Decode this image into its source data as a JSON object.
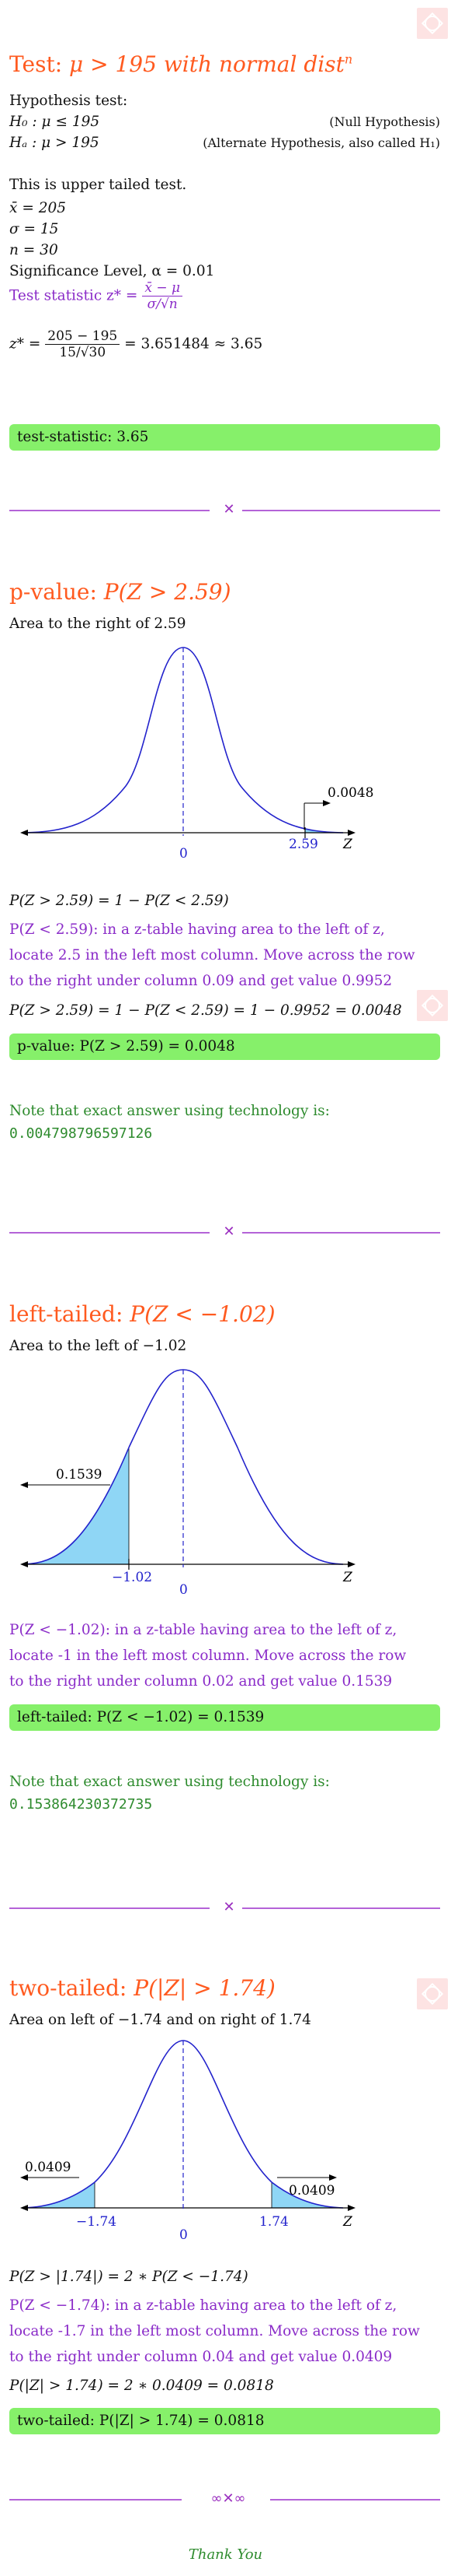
{
  "section1": {
    "title_prefix": "Test: ",
    "title_math": "μ > 195 with normal dist",
    "title_sup": "n",
    "hyp_heading": "Hypothesis test:",
    "h0": "H₀ : μ ≤ 195",
    "h0_note": "(Null Hypothesis)",
    "ha": "Hₐ : μ > 195",
    "ha_note": "(Alternate Hypothesis, also called H₁)",
    "tail_text": "This is upper tailed test.",
    "xbar": "x̄ = 205",
    "sigma": "σ = 15",
    "n": "n = 30",
    "significance": "Significance Level, α = 0.01",
    "ts_label": "Test statistic z* =",
    "ts_num": "x̄ − μ",
    "ts_den": "σ/√n",
    "z_label": "z* =",
    "z_num": "205 − 195",
    "z_den": "15/√30",
    "z_result": "= 3.651484 ≈ 3.65",
    "box": "test-statistic:  3.65"
  },
  "section2": {
    "title_prefix": "p-value: ",
    "title_math": "P(Z > 2.59)",
    "area_text": "Area to the right of 2.59",
    "line1": "P(Z > 2.59) = 1 − P(Z < 2.59)",
    "purple_line1": "P(Z < 2.59): in a z-table having area to the left of z,",
    "purple_line2": "locate 2.5 in the left most column. Move across the row",
    "purple_line3": "to the right under column 0.09 and get value 0.9952",
    "line2": "P(Z > 2.59) = 1 − P(Z < 2.59) = 1 − 0.9952 = 0.0048",
    "box": "p-value:  P(Z > 2.59) = 0.0048",
    "tech_note": "Note that exact answer using technology is:",
    "tech_value": "0.004798796597126",
    "graph": {
      "zero": "0",
      "z": "Z",
      "cut": "2.59",
      "area": "0.0048"
    }
  },
  "section3": {
    "title_prefix": "left-tailed: ",
    "title_math": "P(Z < −1.02)",
    "area_text": "Area to the left of −1.02",
    "purple_line1": "P(Z < −1.02): in a z-table having area to the left of z,",
    "purple_line2": "locate -1 in the left most column. Move across the row",
    "purple_line3": "to the right under column 0.02 and get value 0.1539",
    "box": "left-tailed:  P(Z < −1.02) = 0.1539",
    "tech_note": "Note that exact answer using technology is:",
    "tech_value": "0.153864230372735",
    "graph": {
      "zero": "0",
      "z": "Z",
      "cut": "−1.02",
      "area": "0.1539"
    }
  },
  "section4": {
    "title_prefix": "two-tailed: ",
    "title_math": "P(|Z| > 1.74)",
    "area_text": "Area on left of −1.74 and on right of 1.74",
    "line1": "P(Z > |1.74|) = 2 ∗ P(Z < −1.74)",
    "purple_line1": "P(Z < −1.74): in a z-table having area to the left of z,",
    "purple_line2": "locate -1.7 in the left most column. Move across the row",
    "purple_line3": "to the right under column 0.04 and get value 0.0409",
    "line2": "P(|Z| > 1.74) = 2 ∗ 0.0409 = 0.0818",
    "box": "two-tailed:  P(|Z| > 1.74) = 0.0818",
    "graph": {
      "zero": "0",
      "z": "Z",
      "cut_left": "−1.74",
      "cut_right": "1.74",
      "area_left": "0.0409",
      "area_right": "0.0409"
    }
  },
  "footer": {
    "thanks": "Thank You"
  },
  "colors": {
    "title": "#ff5a1f",
    "purple": "#8a2bc8",
    "green": "#2e8b2e",
    "box": "#86f06a",
    "curve": "#2222cc",
    "shade": "#8fd6f5"
  }
}
